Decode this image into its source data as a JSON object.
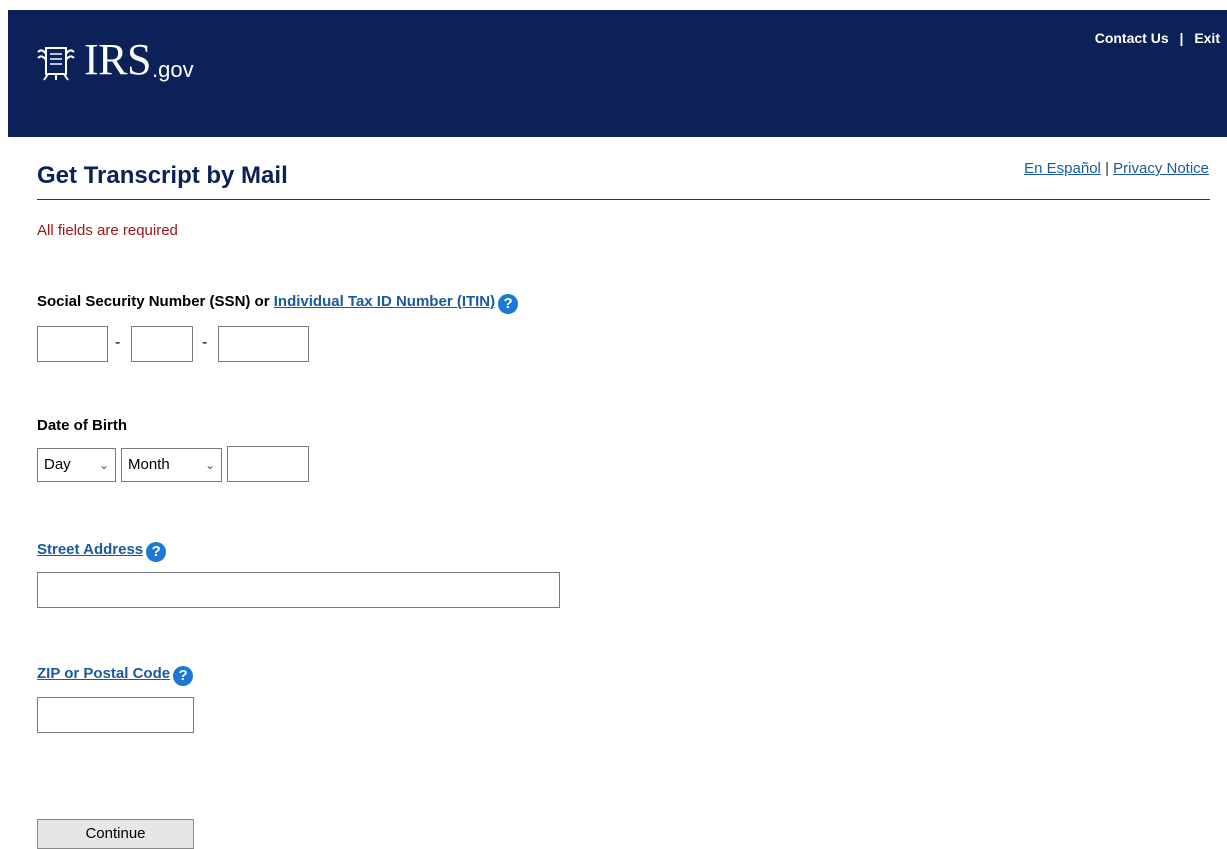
{
  "header": {
    "logo_irs": "IRS",
    "logo_gov": ".gov",
    "contact_label": "Contact Us",
    "separator": "|",
    "exit_label": "Exit"
  },
  "page": {
    "title": "Get Transcript by Mail",
    "espanol_label": "En Español",
    "links_separator": "|",
    "privacy_label": "Privacy Notice",
    "required_note": "All fields are required"
  },
  "form": {
    "ssn": {
      "label_prefix": "Social Security Number (SSN) or ",
      "label_link": "Individual Tax ID Number (ITIN)",
      "dash": "-"
    },
    "dob": {
      "label": "Date of Birth",
      "day_selected": "Day",
      "month_selected": "Month"
    },
    "street": {
      "label": "Street Address"
    },
    "zip": {
      "label": "ZIP or Postal Code"
    },
    "help_glyph": "?",
    "continue_label": "Continue"
  },
  "colors": {
    "header_bg": "#0b2158",
    "link": "#1a5aa0",
    "required_text": "#a01616",
    "help_icon": "#1a78d6"
  }
}
